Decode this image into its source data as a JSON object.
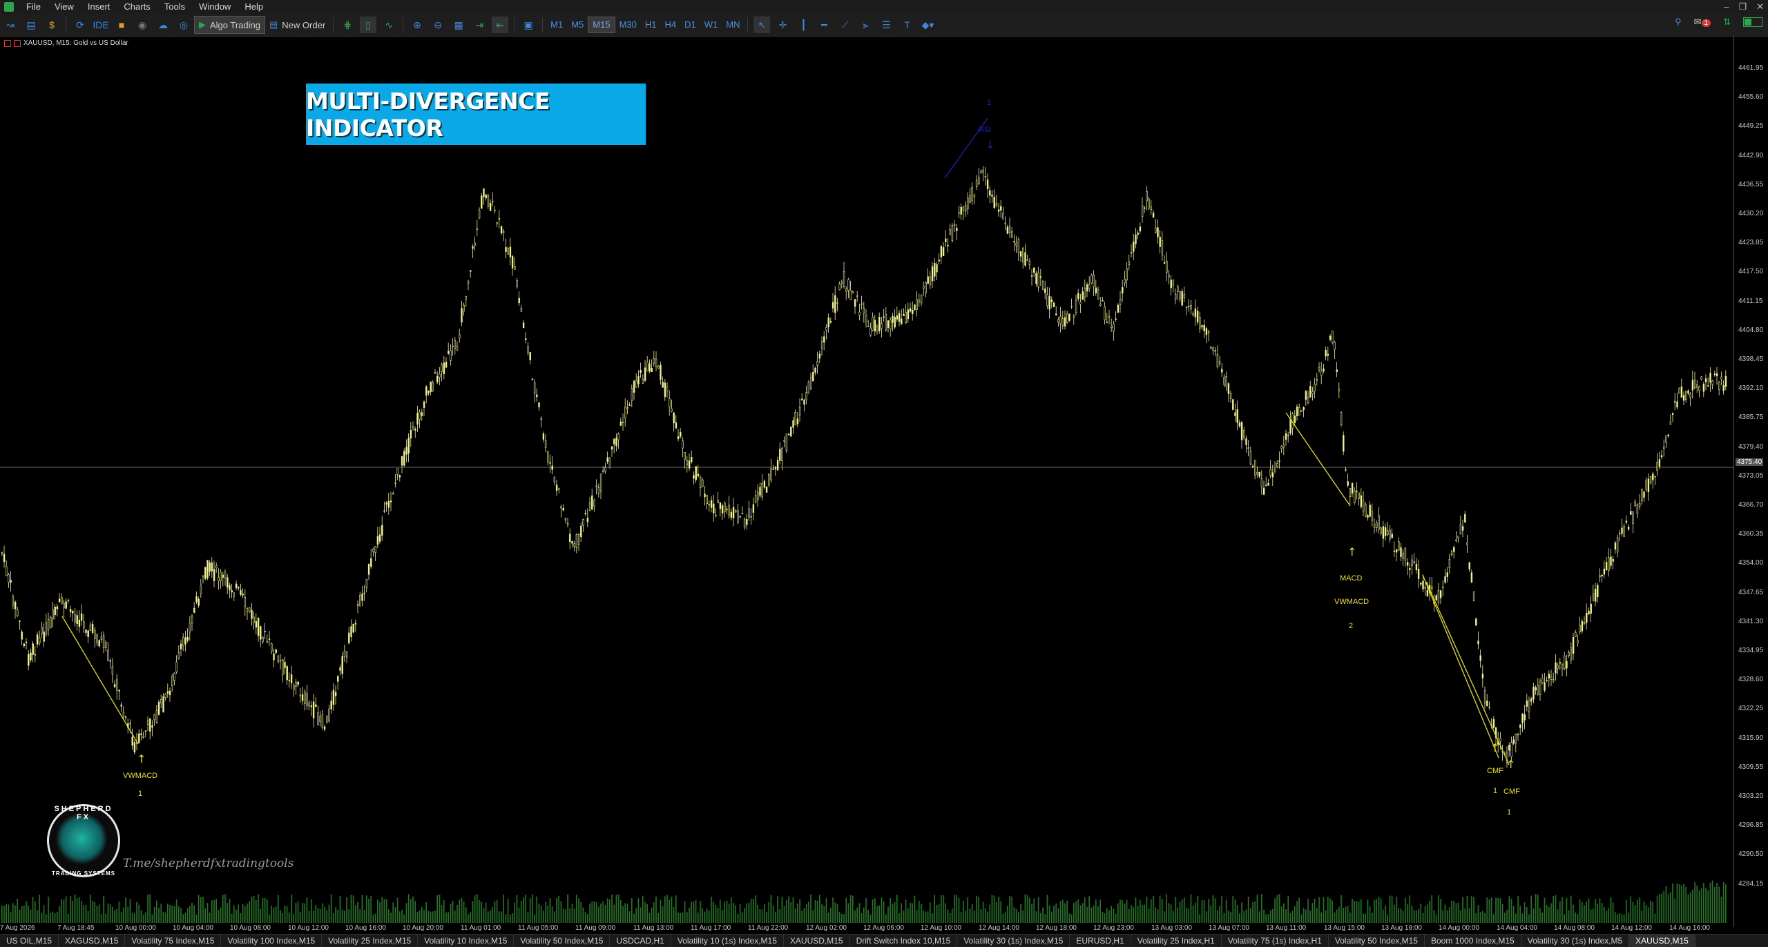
{
  "menu": [
    "File",
    "View",
    "Insert",
    "Charts",
    "Tools",
    "Window",
    "Help"
  ],
  "toolbar": {
    "algo_trading": "Algo Trading",
    "new_order": "New Order",
    "ide": "IDE",
    "timeframes": [
      "M1",
      "M5",
      "M15",
      "M30",
      "H1",
      "H4",
      "D1",
      "W1",
      "MN"
    ],
    "active_timeframe": "M15",
    "notifications": "1"
  },
  "chart": {
    "symbol_title": "XAUUSD, M15:  Gold vs US Dollar",
    "banner_text": "MULTI-DIVERGENCE INDICATOR",
    "watermark_link": "T.me/shepherdfxtradingtools",
    "logo_top": "SHEPHERD FX",
    "logo_bottom": "TRADING SYSTEMS",
    "current_price": "4375.40",
    "price_labels": [
      "4461.95",
      "4455.60",
      "4449.25",
      "4442.90",
      "4436.55",
      "4430.20",
      "4423.85",
      "4417.50",
      "4411.15",
      "4404.80",
      "4398.45",
      "4392.10",
      "4385.75",
      "4379.40",
      "4373.05",
      "4366.70",
      "4360.35",
      "4354.00",
      "4347.65",
      "4341.30",
      "4334.95",
      "4328.60",
      "4322.25",
      "4315.90",
      "4309.55",
      "4303.20",
      "4296.85",
      "4290.50",
      "4284.15"
    ],
    "time_labels": [
      "7 Aug 2026",
      "7 Aug 18:45",
      "10 Aug 00:00",
      "10 Aug 04:00",
      "10 Aug 08:00",
      "10 Aug 12:00",
      "10 Aug 16:00",
      "10 Aug 20:00",
      "11 Aug 01:00",
      "11 Aug 05:00",
      "11 Aug 09:00",
      "11 Aug 13:00",
      "11 Aug 17:00",
      "11 Aug 22:00",
      "12 Aug 02:00",
      "12 Aug 06:00",
      "12 Aug 10:00",
      "12 Aug 14:00",
      "12 Aug 18:00",
      "12 Aug 23:00",
      "13 Aug 03:00",
      "13 Aug 07:00",
      "13 Aug 11:00",
      "13 Aug 15:00",
      "13 Aug 19:00",
      "14 Aug 00:00",
      "14 Aug 04:00",
      "14 Aug 08:00",
      "14 Aug 12:00",
      "14 Aug 16:00"
    ],
    "annotations": {
      "a1_name": "VWMACD",
      "a1_count": "1",
      "a2_name1": "MACD",
      "a2_name2": "VWMACD",
      "a2_count": "2",
      "a3_name": "CMF",
      "a3_count": "1",
      "a4_name": "CMF",
      "a4_count": "1",
      "a5_name": "RSI",
      "a5_count": "1"
    },
    "colors": {
      "candle": "#f2f28a",
      "divergence_line": "#e8e000",
      "volume": "#1f7a1f",
      "banner": "#0aa8e6",
      "bearish_marker": "#1d1fb0"
    }
  },
  "tabs": [
    "US OIL,M15",
    "XAGUSD,M15",
    "Volatility 75 Index,M15",
    "Volatility 100 Index,M15",
    "Volatility 25 Index,M15",
    "Volatility 10 Index,M15",
    "Volatility 50 Index,M15",
    "USDCAD,H1",
    "Volatility 10 (1s) Index,M15",
    "XAUUSD,M15",
    "Drift Switch Index 10,M15",
    "Volatility 30 (1s) Index,M15",
    "EURUSD,H1",
    "Volatility 25 Index,H1",
    "Volatility 75 (1s) Index,H1",
    "Volatility 50 Index,M15",
    "Boom 1000 Index,M15",
    "Volatility 30 (1s) Index,M5",
    "XAUUSD,M15"
  ],
  "active_tab": 18
}
